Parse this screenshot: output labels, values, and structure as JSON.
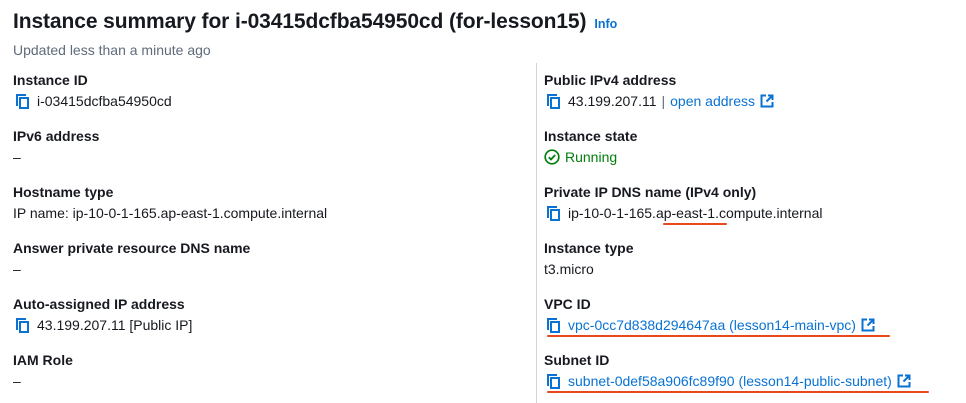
{
  "header": {
    "title": "Instance summary for i-03415dcfba54950cd (for-lesson15)",
    "info_label": "Info",
    "subtitle": "Updated less than a minute ago"
  },
  "left": {
    "instance_id": {
      "label": "Instance ID",
      "value": "i-03415dcfba54950cd"
    },
    "ipv6": {
      "label": "IPv6 address",
      "value": "–"
    },
    "hostname_type": {
      "label": "Hostname type",
      "value": "IP name: ip-10-0-1-165.ap-east-1.compute.internal"
    },
    "answer_dns": {
      "label": "Answer private resource DNS name",
      "value": "–"
    },
    "auto_ip": {
      "label": "Auto-assigned IP address",
      "value": "43.199.207.11 [Public IP]"
    },
    "iam_role": {
      "label": "IAM Role",
      "value": "–"
    }
  },
  "right": {
    "public_ipv4": {
      "label": "Public IPv4 address",
      "value": "43.199.207.11",
      "separator": "|",
      "link_label": "open address"
    },
    "instance_state": {
      "label": "Instance state",
      "value": "Running"
    },
    "private_dns": {
      "label": "Private IP DNS name (IPv4 only)",
      "value": "ip-10-0-1-165.ap-east-1.compute.internal"
    },
    "instance_type": {
      "label": "Instance type",
      "value": "t3.micro"
    },
    "vpc_id": {
      "label": "VPC ID",
      "value": "vpc-0cc7d838d294647aa (lesson14-main-vpc)"
    },
    "subnet_id": {
      "label": "Subnet ID",
      "value": "subnet-0def58a906fc89f90 (lesson14-public-subnet)"
    }
  },
  "colors": {
    "link": "#0972d3",
    "running": "#037f0c",
    "annotation": "#e8481b",
    "muted": "#5f6b7a"
  }
}
